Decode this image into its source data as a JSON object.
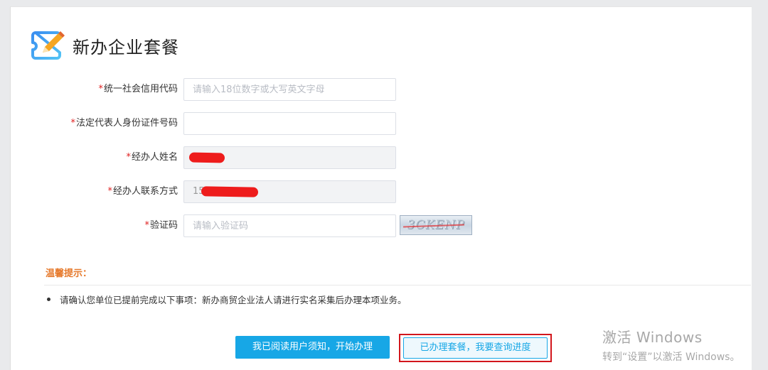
{
  "header": {
    "title": "新办企业套餐",
    "logo_icon": "edit-pencil-icon"
  },
  "form": {
    "required_mark": "*",
    "credit_code": {
      "label": "统一社会信用代码",
      "placeholder": "请输入18位数字或大写英文字母",
      "value": ""
    },
    "legal_id": {
      "label": "法定代表人身份证件号码",
      "placeholder": "",
      "value": ""
    },
    "agent_name": {
      "label": "经办人姓名",
      "value": ""
    },
    "agent_phone": {
      "label": "经办人联系方式",
      "value": "15"
    },
    "captcha": {
      "label": "验证码",
      "placeholder": "请输入验证码",
      "image_text": "3CKENP"
    }
  },
  "tips": {
    "title": "温馨提示：",
    "items": [
      "请确认您单位已提前完成以下事项：新办商贸企业法人请进行实名采集后办理本项业务。"
    ]
  },
  "buttons": {
    "start": "我已阅读用户须知，开始办理",
    "query": "已办理套餐，我要查询进度"
  },
  "watermark": {
    "title": "激活 Windows",
    "subtitle": "转到“设置”以激活 Windows。"
  },
  "colors": {
    "accent": "#17a7e6",
    "required": "#e02020",
    "tips": "#e6792b",
    "highlight_frame": "#d2161c"
  }
}
